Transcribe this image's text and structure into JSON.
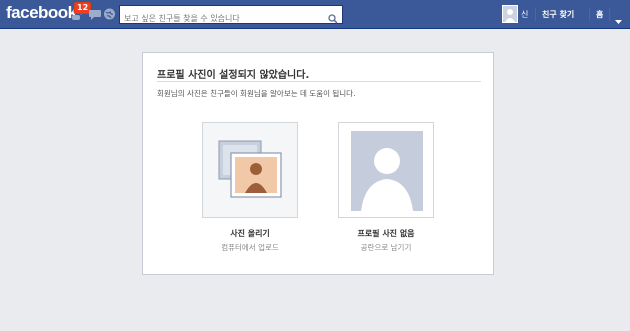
{
  "header": {
    "logo": "facebook",
    "notification_count": "12",
    "search_placeholder": "보고 싶은 친구들 찾을 수 있습니다",
    "user_name": "신",
    "find_friends": "친구 찾기",
    "home": "홈"
  },
  "dialog": {
    "title": "프로필 사진이 설정되지 않았습니다.",
    "description": "회원님의 사진은 친구들이 회원님을 알아보는 데 도움이 됩니다.",
    "options": [
      {
        "title": "사진 올리기",
        "subtitle": "컴퓨터에서 업로드"
      },
      {
        "title": "프로필 사진 없음",
        "subtitle": "공란으로 남기기"
      }
    ]
  },
  "colors": {
    "brand": "#3b5998",
    "badge": "#f03d25",
    "background": "#e9ebee"
  }
}
